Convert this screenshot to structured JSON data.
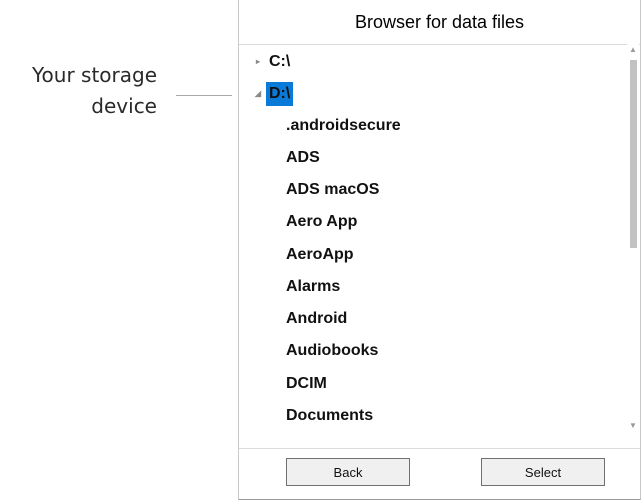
{
  "annotation": {
    "text": "Your storage\ndevice"
  },
  "dialog": {
    "title": "Browser for data files",
    "tree": [
      {
        "label": "C:\\",
        "expander": "▸",
        "selected": false
      },
      {
        "label": "D:\\",
        "expander": "◢",
        "selected": true
      },
      {
        "label": ".androidsecure"
      },
      {
        "label": "ADS"
      },
      {
        "label": "ADS macOS"
      },
      {
        "label": "Aero App"
      },
      {
        "label": "AeroApp"
      },
      {
        "label": "Alarms"
      },
      {
        "label": "Android"
      },
      {
        "label": "Audiobooks"
      },
      {
        "label": "DCIM"
      },
      {
        "label": "Documents"
      }
    ],
    "scrollbar": {
      "up_arrow": "▲",
      "down_arrow": "▼"
    },
    "buttons": {
      "back_label": "Back",
      "select_label": "Select"
    },
    "selection_color": "#0a7ad9"
  }
}
